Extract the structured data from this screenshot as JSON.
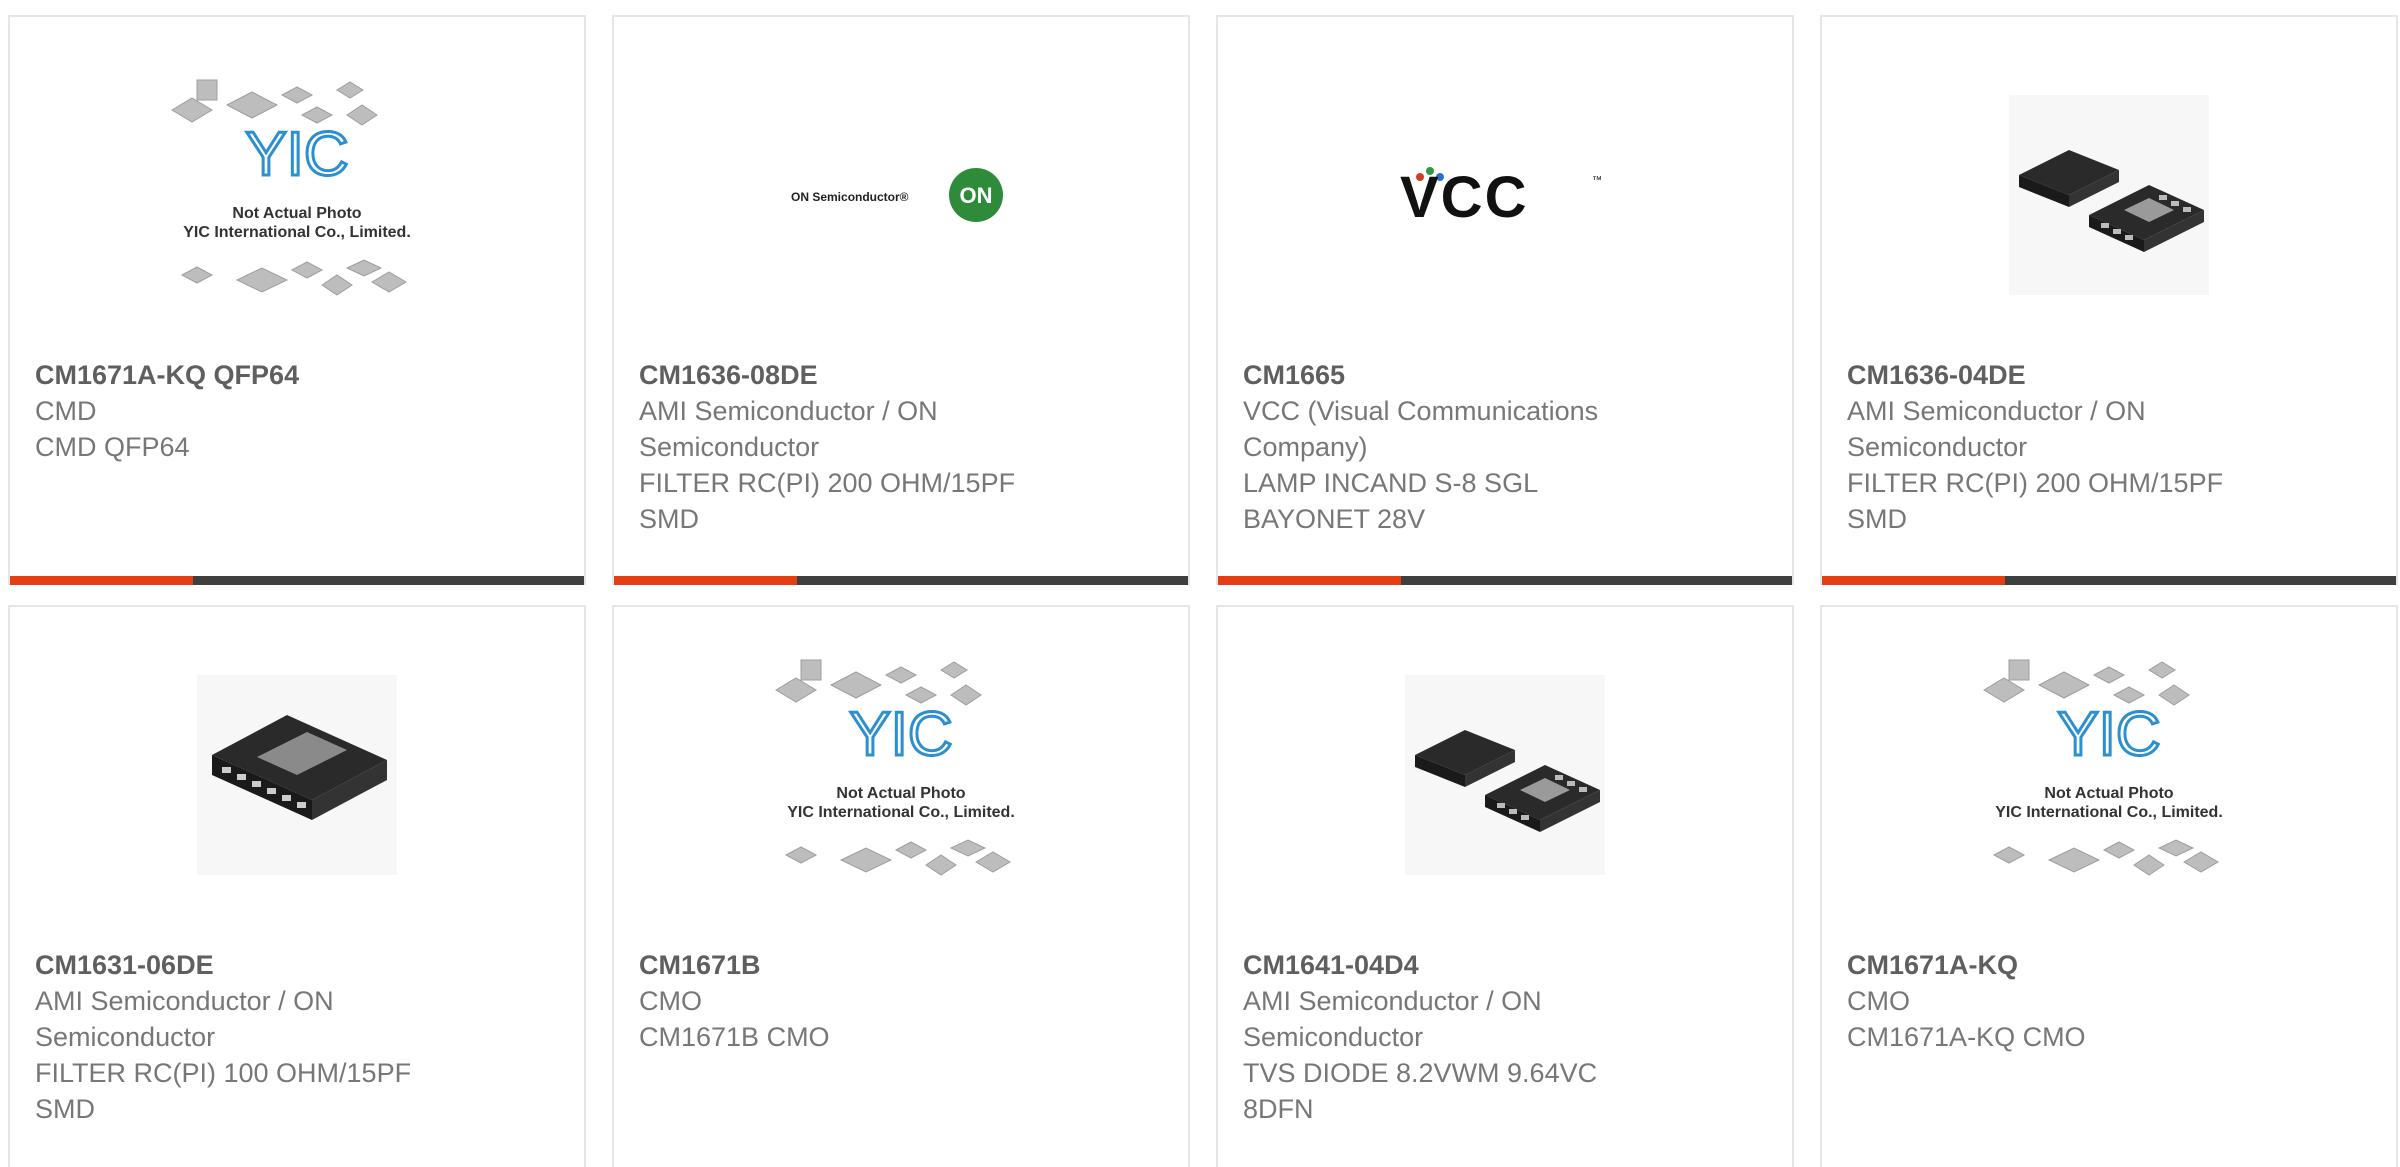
{
  "products": [
    {
      "part": "CM1671A-KQ QFP64",
      "manufacturer": "CMD",
      "description": "CMD QFP64",
      "image": "placeholder-photo",
      "img_text": [
        "Not Actual Photo",
        "YIC International Co., Limited."
      ],
      "logo_text": "YIC"
    },
    {
      "part": "CM1636-08DE",
      "manufacturer": "AMI Semiconductor / ON Semiconductor",
      "description": "FILTER RC(PI) 200 OHM/15PF SMD",
      "image": "on-semi-logo",
      "logo_text": "ON Semiconductor®",
      "badge_text": "ON"
    },
    {
      "part": "CM1665",
      "manufacturer": "VCC (Visual Communications Company)",
      "description": "LAMP INCAND S-8 SGL BAYONET 28V",
      "image": "vcc-logo",
      "logo_text": "VCC",
      "tm": "™"
    },
    {
      "part": "CM1636-04DE",
      "manufacturer": "AMI Semiconductor / ON Semiconductor",
      "description": "FILTER RC(PI) 200 OHM/15PF SMD",
      "image": "dfn-chip-photo"
    },
    {
      "part": "CM1631-06DE",
      "manufacturer": "AMI Semiconductor / ON Semiconductor",
      "description": "FILTER RC(PI) 100 OHM/15PF SMD",
      "image": "udfn-chip-photo"
    },
    {
      "part": "CM1671B",
      "manufacturer": "CMO",
      "description": "CM1671B CMO",
      "image": "placeholder-photo",
      "img_text": [
        "Not Actual Photo",
        "YIC International Co., Limited."
      ],
      "logo_text": "YIC"
    },
    {
      "part": "CM1641-04D4",
      "manufacturer": "AMI Semiconductor / ON Semiconductor",
      "description": "TVS DIODE 8.2VWM 9.64VC 8DFN",
      "image": "dfn-chip-photo"
    },
    {
      "part": "CM1671A-KQ",
      "manufacturer": "CMO",
      "description": "CM1671A-KQ CMO",
      "image": "placeholder-photo",
      "img_text": [
        "Not Actual Photo",
        "YIC International Co., Limited."
      ],
      "logo_text": "YIC"
    }
  ],
  "colors": {
    "accent": "#e43e15",
    "bar": "#3f3f3f",
    "text": "#777777",
    "title": "#5f5f5f",
    "logo_blue": "#2b8fd1",
    "on_green": "#2e8b3a"
  }
}
